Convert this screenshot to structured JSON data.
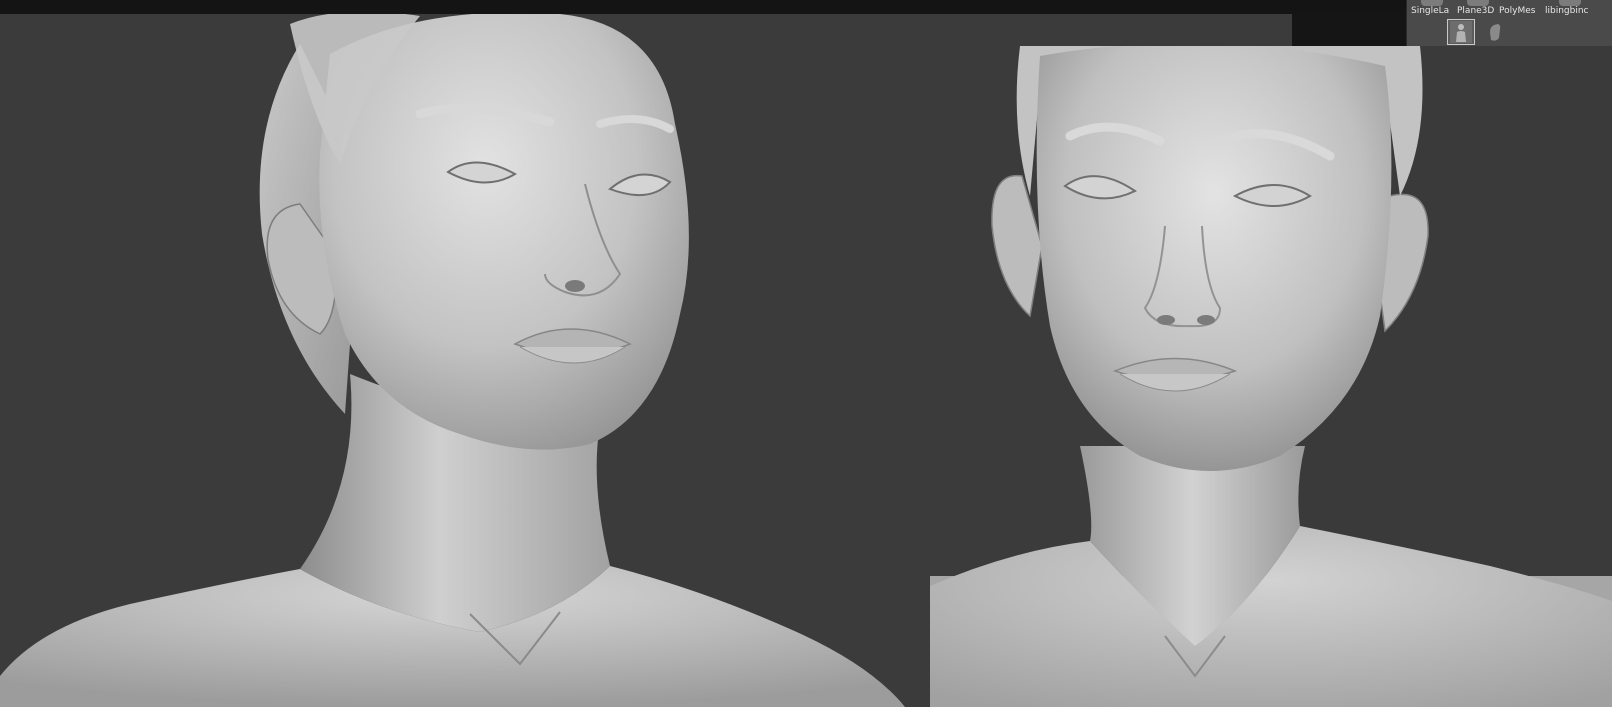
{
  "tool_palette": {
    "items": [
      {
        "label": "SingleLa",
        "icon": "single-layer-brush-icon"
      },
      {
        "label": "Plane3D",
        "icon": "plane3d-icon"
      },
      {
        "label": "PolyMes",
        "icon": "polymesh-icon"
      },
      {
        "label": "libingbinc",
        "icon": "tool-icon"
      }
    ],
    "slots": [
      {
        "icon": "figure-tool-icon",
        "active": true
      },
      {
        "icon": "hand-tool-icon",
        "active": false
      }
    ]
  },
  "viewports": [
    {
      "name": "left-viewport",
      "subject": "three-quarter sculpt view"
    },
    {
      "name": "right-viewport",
      "subject": "front sculpt view"
    }
  ],
  "colors": {
    "canvas": "#3b3b3b",
    "topbar": "#141414",
    "palette": "#4a4a4a",
    "clay": "#bdbdbd"
  }
}
